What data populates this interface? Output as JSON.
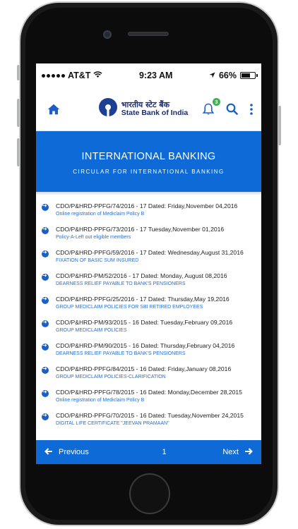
{
  "status_bar": {
    "carrier": "AT&T",
    "time": "9:23 AM",
    "battery": "66%",
    "battery_level": 0.66
  },
  "header": {
    "logo_hindi": "भारतीय स्टेट बैंक",
    "logo_english": "State Bank of India",
    "notification_count": "3",
    "icons": [
      "home-icon",
      "bell-icon",
      "search-icon",
      "kebab-menu-icon"
    ]
  },
  "banner": {
    "title": "INTERNATIONAL BANKING",
    "subtitle": "CIRCULAR FOR INTERNATIONAL BANKING"
  },
  "circulars": [
    {
      "title": "CDO/P&HRD-PPFG/74/2016 - 17 Dated: Friday,November 04,2016",
      "subtitle": "Online registration of Mediclaim Policy B"
    },
    {
      "title": "CDO/P&HRD-PPFG/73/2016 - 17 Tuesday,November 01,2016",
      "subtitle": "Policy-A-Left out eligible members"
    },
    {
      "title": "CDO/P&HRD-PPFG/59/2016 - 17 Dated: Wednesday,August 31,2016",
      "subtitle": "FIXATION OF BASIC SUM INSURED"
    },
    {
      "title": "CDO/P&HRD-PM/52/2016 - 17 Dated: Monday, August 08,2016",
      "subtitle": "DEARNESS RELIEF PAYABLE TO BANK'S PENSIONERS"
    },
    {
      "title": "CDO/P&HRD-PPFG/25/2016 - 17 Dated: Thursday,May 19,2016",
      "subtitle": "GROUP MEDICLAIM POLICIES FOR SBI RETIRED EMPLOYEES"
    },
    {
      "title": "CDO/P&HRD-PM/93/2015 - 16 Dated: Tuesday,February 09,2016",
      "subtitle": "GROUP MEDICLAIM POLICIES"
    },
    {
      "title": "CDO/P&HRD-PM/90/2015 - 16 Dated: Thursday,February 04,2016",
      "subtitle": "DEARNESS RELIEF PAYABLE TO BANK'S PENSIONERS"
    },
    {
      "title": "CDO/P&HRD-PPFG/84/2015 - 16 Dated: Friday,January 08,2016",
      "subtitle": "GROUP MEDICLAIM POLICIES-CLARIFICATION"
    },
    {
      "title": "CDO/P&HRD-PPFG/78/2015 - 16 Dated: Monday,December 28,2015",
      "subtitle": "Online registration of Mediclaim Policy B"
    },
    {
      "title": "CDO/P&HRD-PPFG/70/2015 - 16 Dated: Tuesday,November 24,2015",
      "subtitle": "DIGITAL LIFE CERTIFICATE \"JEEVAN PRAMAAN\""
    }
  ],
  "pager": {
    "previous_label": "Previous",
    "page": "1",
    "next_label": "Next"
  },
  "colors": {
    "brand_blue": "#0d6ad6",
    "link_blue": "#2a6fc9",
    "badge_green": "#3ab54a"
  }
}
